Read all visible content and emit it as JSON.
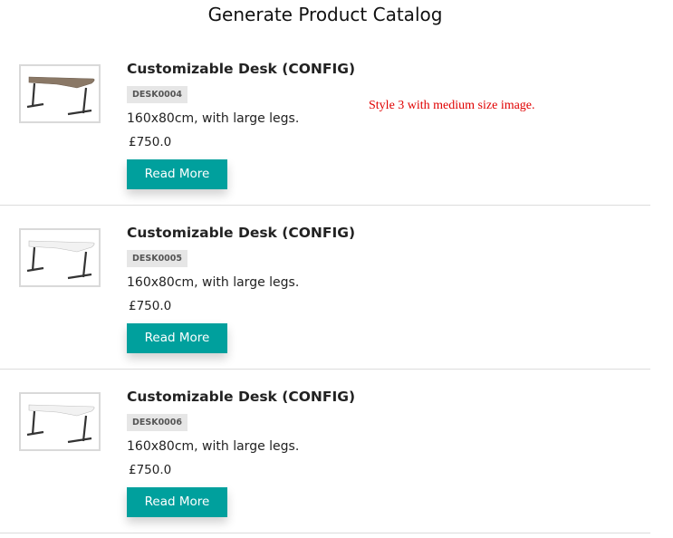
{
  "page": {
    "title": "Generate Product Catalog"
  },
  "note": "Style 3 with medium size image.",
  "products": [
    {
      "name": "Customizable Desk (CONFIG)",
      "sku": "DESK0004",
      "description": "160x80cm, with large legs.",
      "price": "£750.0",
      "button_label": "Read More",
      "top_color": "#8a7866"
    },
    {
      "name": "Customizable Desk (CONFIG)",
      "sku": "DESK0005",
      "description": "160x80cm, with large legs.",
      "price": "£750.0",
      "button_label": "Read More",
      "top_color": "#f2f2f2"
    },
    {
      "name": "Customizable Desk (CONFIG)",
      "sku": "DESK0006",
      "description": "160x80cm, with large legs.",
      "price": "£750.0",
      "button_label": "Read More",
      "top_color": "#f2f2f2"
    }
  ],
  "colors": {
    "button": "#00a09d",
    "note": "#e00000",
    "sku_badge": "#e6e6e6"
  }
}
